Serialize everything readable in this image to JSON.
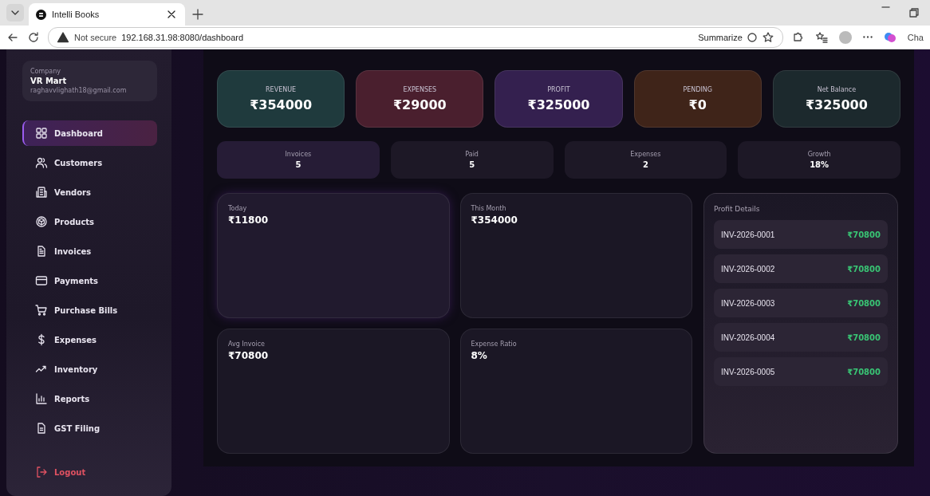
{
  "browser": {
    "tab_title": "Intelli Books",
    "security": "Not secure",
    "url": "192.168.31.98:8080/dashboard",
    "summarize": "Summarize",
    "copilot": "Cha"
  },
  "sidebar": {
    "company_label": "Company",
    "company_name": "VR Mart",
    "email": "raghavvlighath18@gmail.com",
    "items": [
      {
        "label": "Dashboard",
        "selected": true
      },
      {
        "label": "Customers",
        "selected": false
      },
      {
        "label": "Vendors",
        "selected": false
      },
      {
        "label": "Products",
        "selected": false
      },
      {
        "label": "Invoices",
        "selected": false
      },
      {
        "label": "Payments",
        "selected": false
      },
      {
        "label": "Purchase Bills",
        "selected": false
      },
      {
        "label": "Expenses",
        "selected": false
      },
      {
        "label": "Inventory",
        "selected": false
      },
      {
        "label": "Reports",
        "selected": false
      },
      {
        "label": "GST Filing",
        "selected": false
      }
    ],
    "logout": "Logout"
  },
  "stat_cards": [
    {
      "label": "REVENUE",
      "value": "₹354000",
      "color": "#1f3a3d"
    },
    {
      "label": "EXPENSES",
      "value": "₹29000",
      "color": "#4a1f2e"
    },
    {
      "label": "PROFIT",
      "value": "₹325000",
      "color": "#34204f"
    },
    {
      "label": "PENDING",
      "value": "₹0",
      "color": "#3f2419"
    },
    {
      "label": "Net Balance",
      "value": "₹325000",
      "color": "#1c292d"
    }
  ],
  "counts": [
    {
      "label": "Invoices",
      "value": "5"
    },
    {
      "label": "Paid",
      "value": "5"
    },
    {
      "label": "Expenses",
      "value": "2"
    },
    {
      "label": "Growth",
      "value": "18%"
    }
  ],
  "metrics": [
    {
      "label": "Today",
      "value": "₹11800"
    },
    {
      "label": "This Month",
      "value": "₹354000"
    },
    {
      "label": "Avg Invoice",
      "value": "₹70800"
    },
    {
      "label": "Expense Ratio",
      "value": "8%"
    }
  ],
  "profit_details": {
    "title": "Profit Details",
    "rows": [
      {
        "invoice": "INV-2026-0001",
        "amount": "₹70800"
      },
      {
        "invoice": "INV-2026-0002",
        "amount": "₹70800"
      },
      {
        "invoice": "INV-2026-0003",
        "amount": "₹70800"
      },
      {
        "invoice": "INV-2026-0004",
        "amount": "₹70800"
      },
      {
        "invoice": "INV-2026-0005",
        "amount": "₹70800"
      }
    ]
  }
}
